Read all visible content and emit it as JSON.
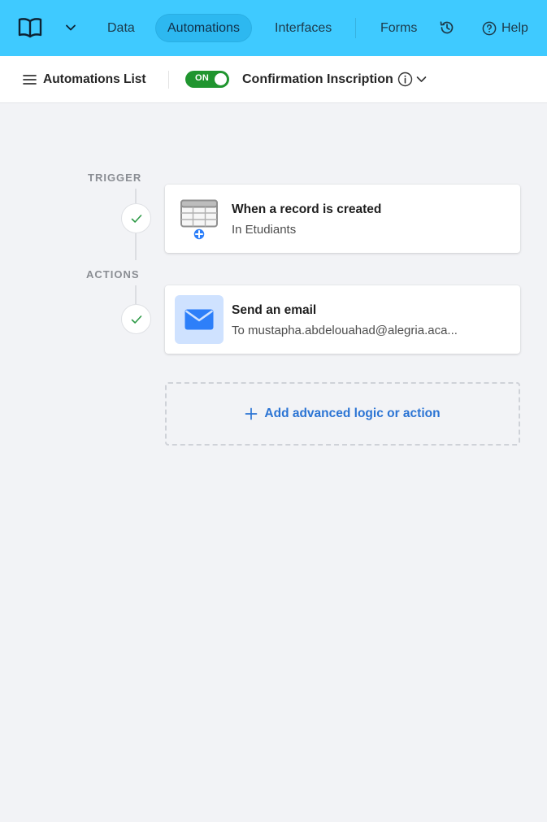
{
  "nav": {
    "tabs": [
      {
        "label": "Data"
      },
      {
        "label": "Automations"
      },
      {
        "label": "Interfaces"
      },
      {
        "label": "Forms"
      }
    ],
    "help_label": "Help"
  },
  "toolbar": {
    "list_label": "Automations List",
    "toggle_label": "ON",
    "automation_name": "Confirmation Inscription"
  },
  "flow": {
    "trigger_label": "TRIGGER",
    "actions_label": "ACTIONS",
    "trigger": {
      "title": "When a record is created",
      "subtitle": "In Etudiants"
    },
    "action": {
      "title": "Send an email",
      "subtitle": "To mustapha.abdelouahad@alegria.aca..."
    },
    "add_label": "Add advanced logic or action"
  },
  "colors": {
    "topbar": "#3fcaff",
    "toggle_on": "#20952f",
    "link": "#2b74d4",
    "mail_tile": "#cfe2ff",
    "mail_icon": "#2d7ff9"
  },
  "icons": [
    "base-logo-icon",
    "chevron-down-icon",
    "history-icon",
    "help-icon",
    "menu-icon",
    "info-icon",
    "check-icon",
    "table-add-icon",
    "mail-icon",
    "plus-icon"
  ]
}
